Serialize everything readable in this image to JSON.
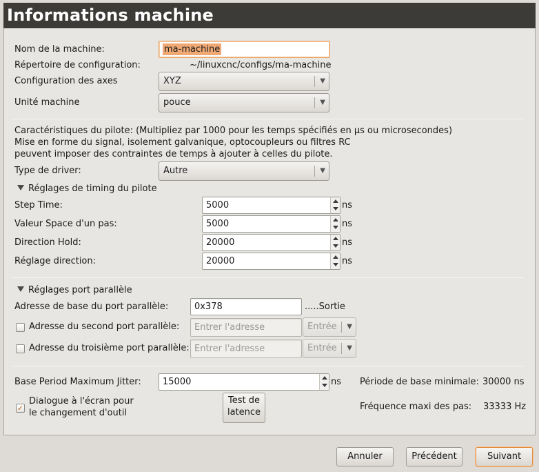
{
  "title": "Informations machine",
  "machine_name": {
    "label": "Nom de la machine:",
    "value": "ma-machine"
  },
  "config_dir": {
    "label": "Répertoire de configuration:",
    "value": "~/linuxcnc/configs/ma-machine"
  },
  "axes": {
    "label": "Configuration des axes",
    "value": "XYZ"
  },
  "units": {
    "label": "Unité machine",
    "value": "pouce"
  },
  "driver_info": {
    "line1": "Caractéristiques du pilote: (Multipliez par 1000 pour les temps spécifiés en µs ou microsecondes)",
    "line2": "Mise en forme du signal, isolement galvanique, optocoupleurs ou filtres RC",
    "line3": "peuvent imposer des contraintes de temps à ajouter à celles du pilote."
  },
  "driver_type": {
    "label": "Type de driver:",
    "value": "Autre"
  },
  "timing": {
    "header": "Réglages de timing du pilote",
    "unit": "ns",
    "step_time": {
      "label": "Step Time:",
      "value": "5000"
    },
    "step_space": {
      "label": "Valeur Space d'un pas:",
      "value": "5000"
    },
    "dir_hold": {
      "label": "Direction Hold:",
      "value": "20000"
    },
    "dir_setup": {
      "label": "Réglage direction:",
      "value": "20000"
    }
  },
  "parport": {
    "header": "Réglages port parallèle",
    "base": {
      "label": "Adresse de base du port parallèle:",
      "value": "0x378",
      "suffix": ".....Sortie"
    },
    "second": {
      "label": "Adresse du second port parallèle:",
      "placeholder": "Entrer l'adresse",
      "mode": "Entrée"
    },
    "third": {
      "label": "Adresse du troisième port parallèle:",
      "placeholder": "Entrer l'adresse",
      "mode": "Entrée"
    }
  },
  "jitter": {
    "label": "Base Period Maximum Jitter:",
    "value": "15000",
    "unit": "ns"
  },
  "base_period": {
    "label": "Période de base minimale:",
    "value": "30000 ns"
  },
  "max_step_freq": {
    "label": "Fréquence maxi des pas:",
    "value": "33333 Hz"
  },
  "toolchange": {
    "line1": "Dialogue à l'écran pour",
    "line2": "le changement d'outil",
    "checked": true
  },
  "latency_button": {
    "line1": "Test de",
    "line2": "latence"
  },
  "footer": {
    "cancel": "Annuler",
    "previous": "Précédent",
    "next": "Suivant"
  },
  "icons": {
    "dropdown": "chevron-down-icon",
    "check": "check-icon",
    "expander": "triangle-down-icon"
  }
}
